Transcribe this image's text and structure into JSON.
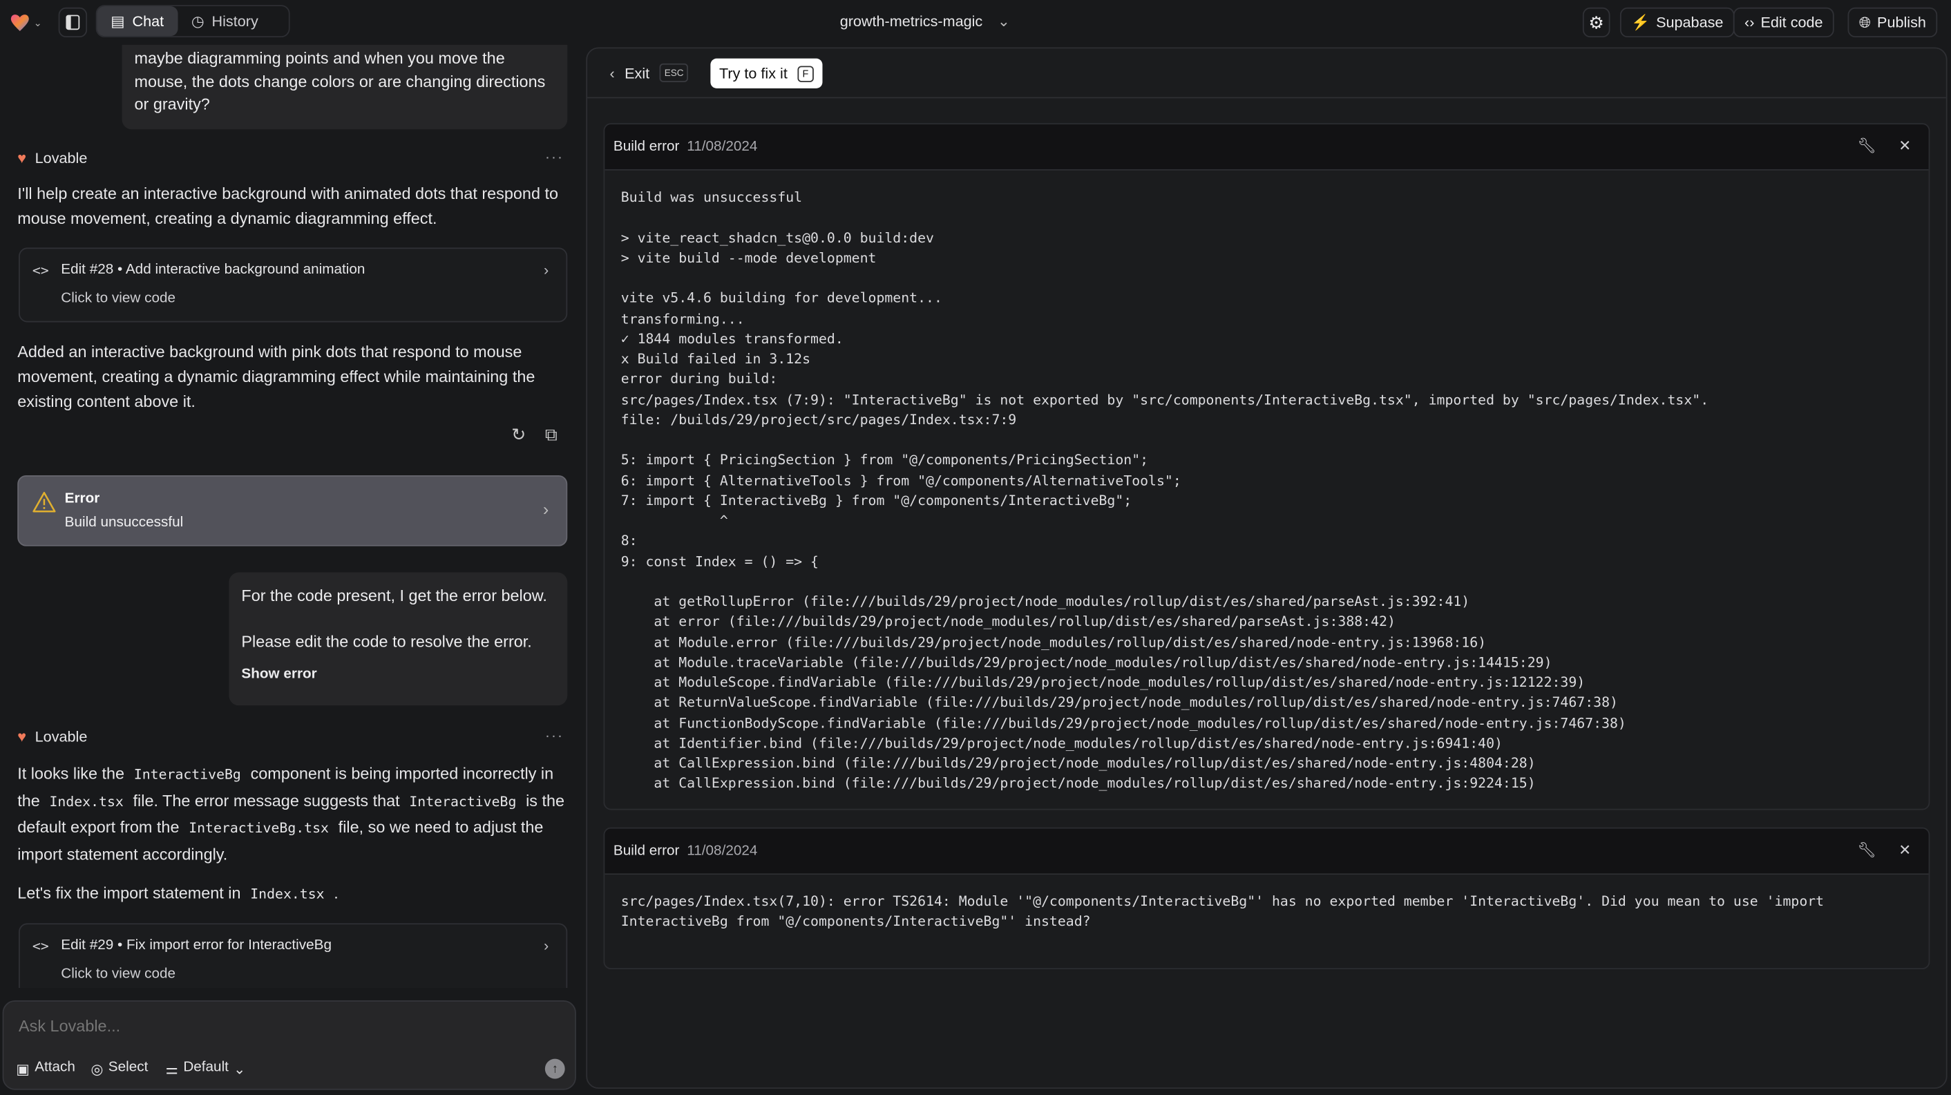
{
  "topbar": {
    "project_name": "growth-metrics-magic",
    "tabs": [
      {
        "label": "Chat",
        "active": true
      },
      {
        "label": "History",
        "active": false
      }
    ],
    "supabase_label": "Supabase",
    "edit_code_label": "Edit code",
    "publish_label": "Publish",
    "supabase_color": "#3ecf8e"
  },
  "chat": {
    "user_message_1": "maybe diagramming points and when you move the mouse, the dots change colors or are changing directions or gravity?",
    "assistant_name": "Lovable",
    "assistant_1_text": "I'll help create an interactive background with animated dots that respond to mouse movement, creating a dynamic diagramming effect.",
    "edit_1": {
      "title": "Edit #28 • Add interactive background animation",
      "subtitle": "Click to view code"
    },
    "assistant_1_summary": "Added an interactive background with pink dots that respond to mouse movement, creating a dynamic diagramming effect while maintaining the existing content above it.",
    "error_card": {
      "title": "Error",
      "subtitle": "Build unsuccessful",
      "icon_color": "#e0b030"
    },
    "user_message_2": {
      "line1": "For the code present, I get the error below.",
      "line2": "Please edit the code to resolve the error.",
      "show_error": "Show error"
    },
    "assistant_2_segments": [
      {
        "t": "It looks like the "
      },
      {
        "t": "InteractiveBg",
        "code": true
      },
      {
        "t": " component is being imported incorrectly in the "
      },
      {
        "t": "Index.tsx",
        "code": true
      },
      {
        "t": " file. The error message suggests that "
      },
      {
        "t": "InteractiveBg",
        "code": true
      },
      {
        "t": " is the default export from the "
      },
      {
        "t": "InteractiveBg.tsx",
        "code": true
      },
      {
        "t": " file, so we need to adjust the import statement accordingly."
      }
    ],
    "assistant_2_fix_segments": [
      {
        "t": "Let's fix the import statement in "
      },
      {
        "t": "Index.tsx",
        "code": true
      },
      {
        "t": " ."
      }
    ],
    "edit_2": {
      "title": "Edit #29 • Fix import error for InteractiveBg",
      "subtitle": "Click to view code"
    },
    "input": {
      "placeholder": "Ask Lovable...",
      "attach": "Attach",
      "select": "Select",
      "mode": "Default"
    }
  },
  "panel": {
    "exit_label": "Exit",
    "exit_key": "ESC",
    "fix_label": "Try to fix it",
    "fix_key": "F",
    "errors": [
      {
        "title": "Build error",
        "date": "11/08/2024",
        "log": "Build was unsuccessful\n\n> vite_react_shadcn_ts@0.0.0 build:dev\n> vite build --mode development\n\nvite v5.4.6 building for development...\ntransforming...\n✓ 1844 modules transformed.\nx Build failed in 3.12s\nerror during build:\nsrc/pages/Index.tsx (7:9): \"InteractiveBg\" is not exported by \"src/components/InteractiveBg.tsx\", imported by \"src/pages/Index.tsx\".\nfile: /builds/29/project/src/pages/Index.tsx:7:9\n\n5: import { PricingSection } from \"@/components/PricingSection\";\n6: import { AlternativeTools } from \"@/components/AlternativeTools\";\n7: import { InteractiveBg } from \"@/components/InteractiveBg\";\n            ^\n8: \n9: const Index = () => {\n\n    at getRollupError (file:///builds/29/project/node_modules/rollup/dist/es/shared/parseAst.js:392:41)\n    at error (file:///builds/29/project/node_modules/rollup/dist/es/shared/parseAst.js:388:42)\n    at Module.error (file:///builds/29/project/node_modules/rollup/dist/es/shared/node-entry.js:13968:16)\n    at Module.traceVariable (file:///builds/29/project/node_modules/rollup/dist/es/shared/node-entry.js:14415:29)\n    at ModuleScope.findVariable (file:///builds/29/project/node_modules/rollup/dist/es/shared/node-entry.js:12122:39)\n    at ReturnValueScope.findVariable (file:///builds/29/project/node_modules/rollup/dist/es/shared/node-entry.js:7467:38)\n    at FunctionBodyScope.findVariable (file:///builds/29/project/node_modules/rollup/dist/es/shared/node-entry.js:7467:38)\n    at Identifier.bind (file:///builds/29/project/node_modules/rollup/dist/es/shared/node-entry.js:6941:40)\n    at CallExpression.bind (file:///builds/29/project/node_modules/rollup/dist/es/shared/node-entry.js:4804:28)\n    at CallExpression.bind (file:///builds/29/project/node_modules/rollup/dist/es/shared/node-entry.js:9224:15)"
      },
      {
        "title": "Build error",
        "date": "11/08/2024",
        "log": "src/pages/Index.tsx(7,10): error TS2614: Module '\"@/components/InteractiveBg\"' has no exported member 'InteractiveBg'. Did you mean to use 'import\nInteractiveBg from \"@/components/InteractiveBg\"' instead?"
      }
    ]
  }
}
